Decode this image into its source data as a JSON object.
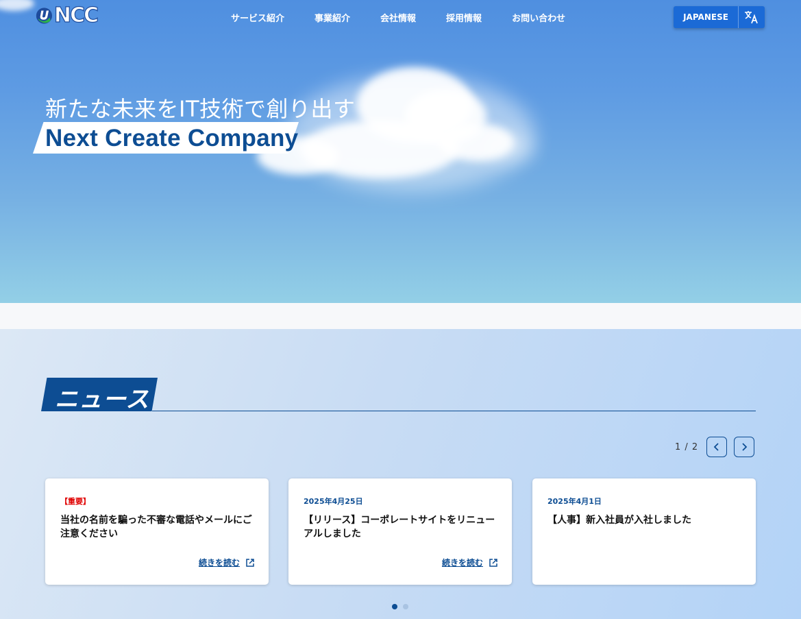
{
  "header": {
    "logo_text": "NCC",
    "nav": [
      "サービス紹介",
      "事業紹介",
      "会社情報",
      "採用情報",
      "お問い合わせ"
    ],
    "language_label": "JAPANESE"
  },
  "hero": {
    "subtitle": "新たな未来をIT技術で創り出す",
    "title": "Next Create Company"
  },
  "news": {
    "heading": "ニュース",
    "pager": "1 / 2",
    "items": [
      {
        "date": "【重要】",
        "title": "当社の名前を騙った不審な電話やメールにご注意ください",
        "link": "続きを読む"
      },
      {
        "date": "2025年4月25日",
        "title": "【リリース】コーポレートサイトをリニューアルしました",
        "link": "続きを読む"
      },
      {
        "date": "2025年4月1日",
        "title": "【人事】新入社員が入社しました",
        "link": ""
      }
    ]
  },
  "colors": {
    "brand_navy": "#0d4d93",
    "accent_blue": "#1b6ad6",
    "important_red": "#e00000"
  },
  "icons": [
    "logo-mark-icon",
    "translate-icon",
    "chevron-left-icon",
    "chevron-right-icon",
    "external-link-icon"
  ]
}
